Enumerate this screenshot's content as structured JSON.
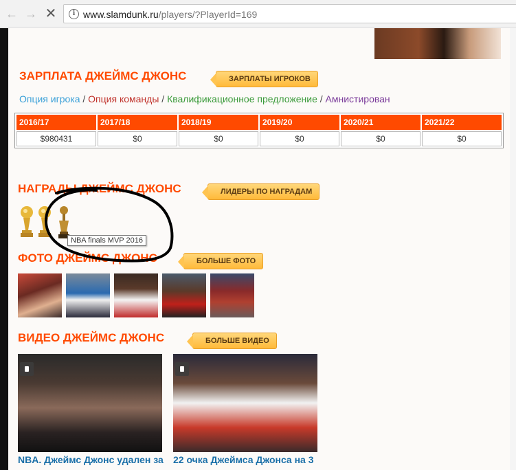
{
  "browser": {
    "url_host": "www.slamdunk.ru",
    "url_path": "/players/?PlayerId=169"
  },
  "salary": {
    "title": "ЗАРПЛАТА ДЖЕЙМС ДЖОНС",
    "button": "ЗАРПЛАТЫ ИГРОКОВ",
    "legend": [
      "Опция игрока",
      "Опция команды",
      "Квалификационное предложение",
      "Амнистирован"
    ],
    "separator": "/",
    "columns": [
      "2016/17",
      "2017/18",
      "2018/19",
      "2019/20",
      "2020/21",
      "2021/22"
    ],
    "values": [
      "$980431",
      "$0",
      "$0",
      "$0",
      "$0",
      "$0"
    ]
  },
  "awards": {
    "title": "НАГРАДЫ ДЖЕЙМС ДЖОНС",
    "button": "ЛИДЕРЫ ПО НАГРАДАМ",
    "tooltip": "NBA finals MVP 2016",
    "items": [
      "championship-trophy",
      "championship-trophy",
      "finals-mvp-trophy"
    ]
  },
  "photos": {
    "title": "ФОТО ДЖЕЙМС ДЖОНС",
    "button": "БОЛЬШЕ ФОТО"
  },
  "videos": {
    "title": "ВИДЕО ДЖЕЙМС ДЖОНС",
    "button": "БОЛЬШЕ ВИДЕО",
    "items": [
      {
        "title": "NBA. Джеймс Джонс удален за"
      },
      {
        "title": "22 очка Джеймса Джонса на 3"
      }
    ]
  },
  "colors": {
    "accent": "#ff4a00",
    "button": "#ffc451",
    "link": "#1a6fa8"
  }
}
